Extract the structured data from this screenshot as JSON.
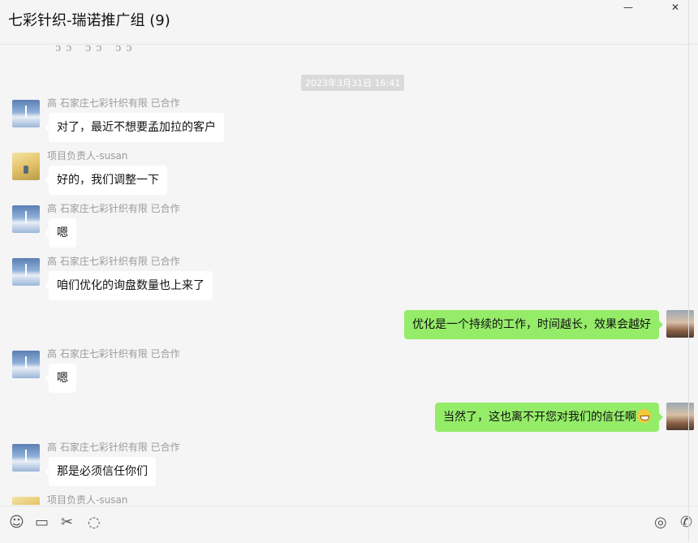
{
  "window": {
    "title": "七彩针织-瑞诺推广组 (9)",
    "controls": {
      "minimize": "—",
      "close": "✕"
    }
  },
  "chat": {
    "partial_emoji": "ᦱᦱ  ᦱᦱ  ᦱᦱ",
    "timestamp": "2023年3月31日 16:41",
    "messages": [
      {
        "sender": "高 石家庄七彩针织有限 已合作",
        "text": "对了，最近不想要孟加拉的客户",
        "direction": "incoming",
        "avatar": "landscape-avatar"
      },
      {
        "sender": "项目负责人-susan",
        "text": "好的，我们调整一下",
        "direction": "incoming",
        "avatar": "wheat-field-avatar"
      },
      {
        "sender": "高 石家庄七彩针织有限 已合作",
        "text": "嗯",
        "direction": "incoming",
        "avatar": "landscape-avatar"
      },
      {
        "sender": "高 石家庄七彩针织有限 已合作",
        "text": "咱们优化的询盘数量也上来了",
        "direction": "incoming",
        "avatar": "landscape-avatar"
      },
      {
        "sender": "",
        "text": "优化是一个持续的工作，时间越长，效果会越好",
        "direction": "outgoing",
        "avatar": "sunset-avatar"
      },
      {
        "sender": "高 石家庄七彩针织有限 已合作",
        "text": "嗯",
        "direction": "incoming",
        "avatar": "landscape-avatar"
      },
      {
        "sender": "",
        "text": "当然了，这也离不开您对我们的信任啊",
        "direction": "outgoing",
        "avatar": "sunset-avatar",
        "emoji": "grin-emoji"
      },
      {
        "sender": "高 石家庄七彩针织有限 已合作",
        "text": "那是必须信任你们",
        "direction": "incoming",
        "avatar": "landscape-avatar"
      },
      {
        "sender": "项目负责人-susan",
        "text": "",
        "direction": "incoming",
        "avatar": "wheat-field-avatar"
      }
    ]
  },
  "toolbar": {
    "icons": {
      "emoji": "☺",
      "folder": "▭",
      "scissors": "✂",
      "chat_history": "◌",
      "live": "◎",
      "phone": "✆"
    }
  }
}
